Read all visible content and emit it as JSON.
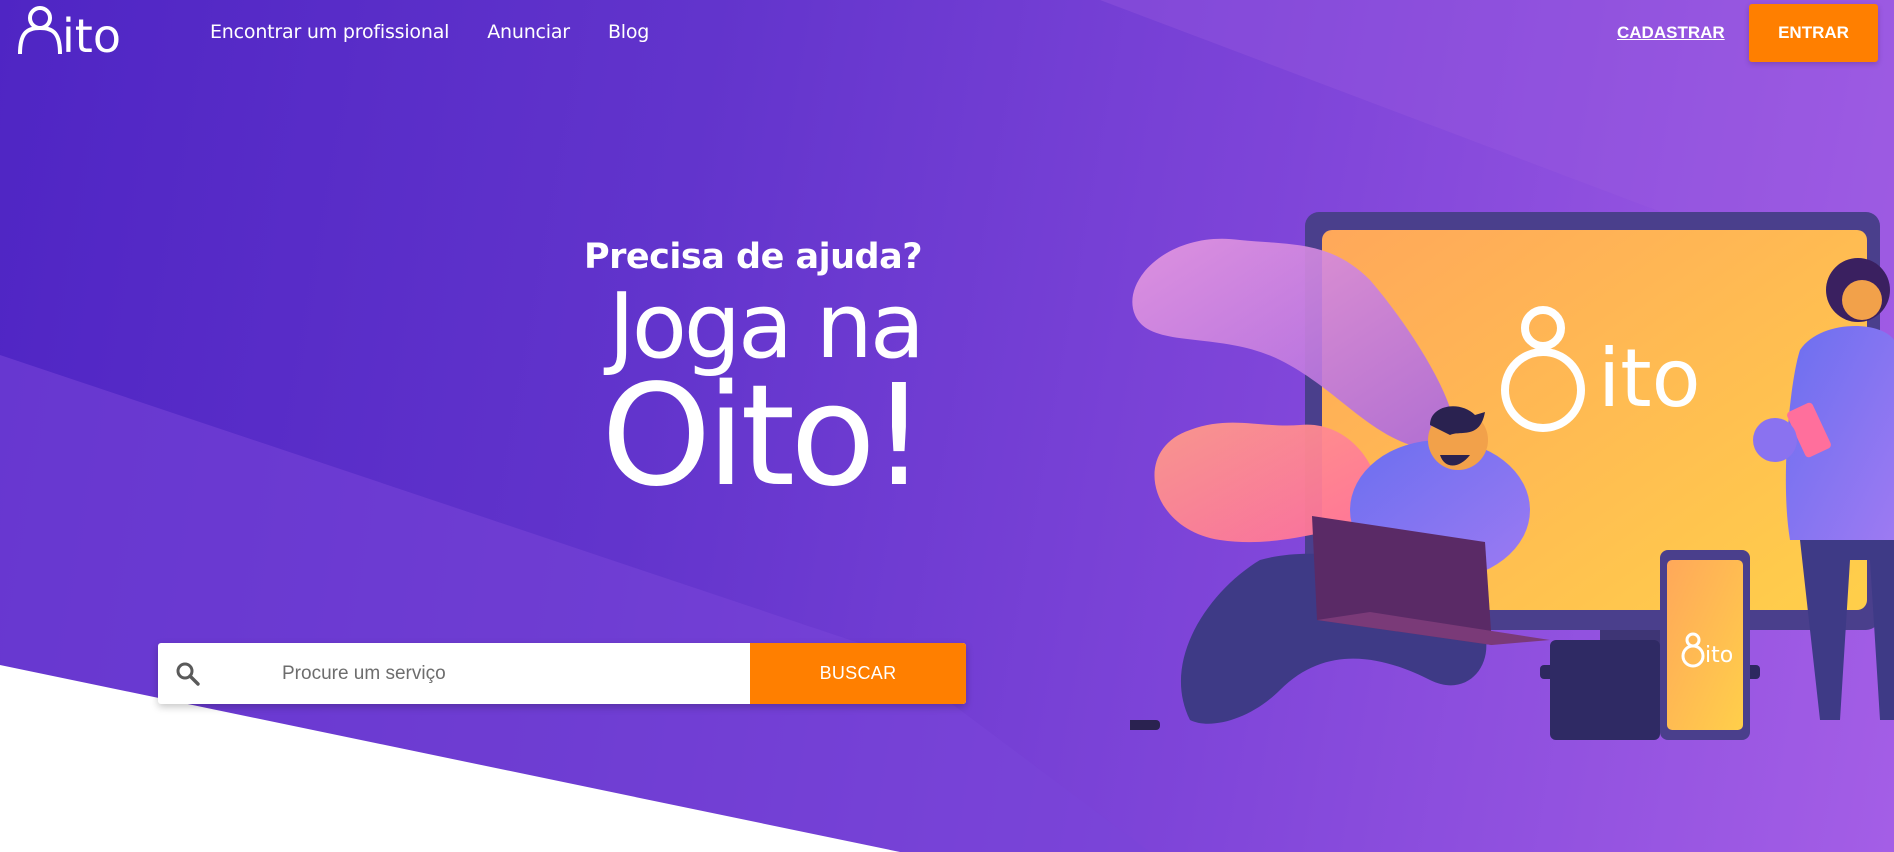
{
  "header": {
    "logo_text": "8ito",
    "nav": [
      {
        "label": "Encontrar um profissional"
      },
      {
        "label": "Anunciar"
      },
      {
        "label": "Blog"
      }
    ],
    "signup_label": "CADASTRAR",
    "login_label": "ENTRAR"
  },
  "hero": {
    "question": "Precisa de ajuda?",
    "headline_line1": "Joga na",
    "headline_line2": "Oito!"
  },
  "search": {
    "placeholder": "Procure um serviço",
    "button_label": "BUSCAR",
    "icon": "search-icon"
  },
  "illustration": {
    "monitor_logo": "8ito",
    "phone_logo": "8ito"
  },
  "colors": {
    "accent": "#ff7f00",
    "hero_bg": "#5a2ec8",
    "text_on_hero": "#ffffff"
  }
}
